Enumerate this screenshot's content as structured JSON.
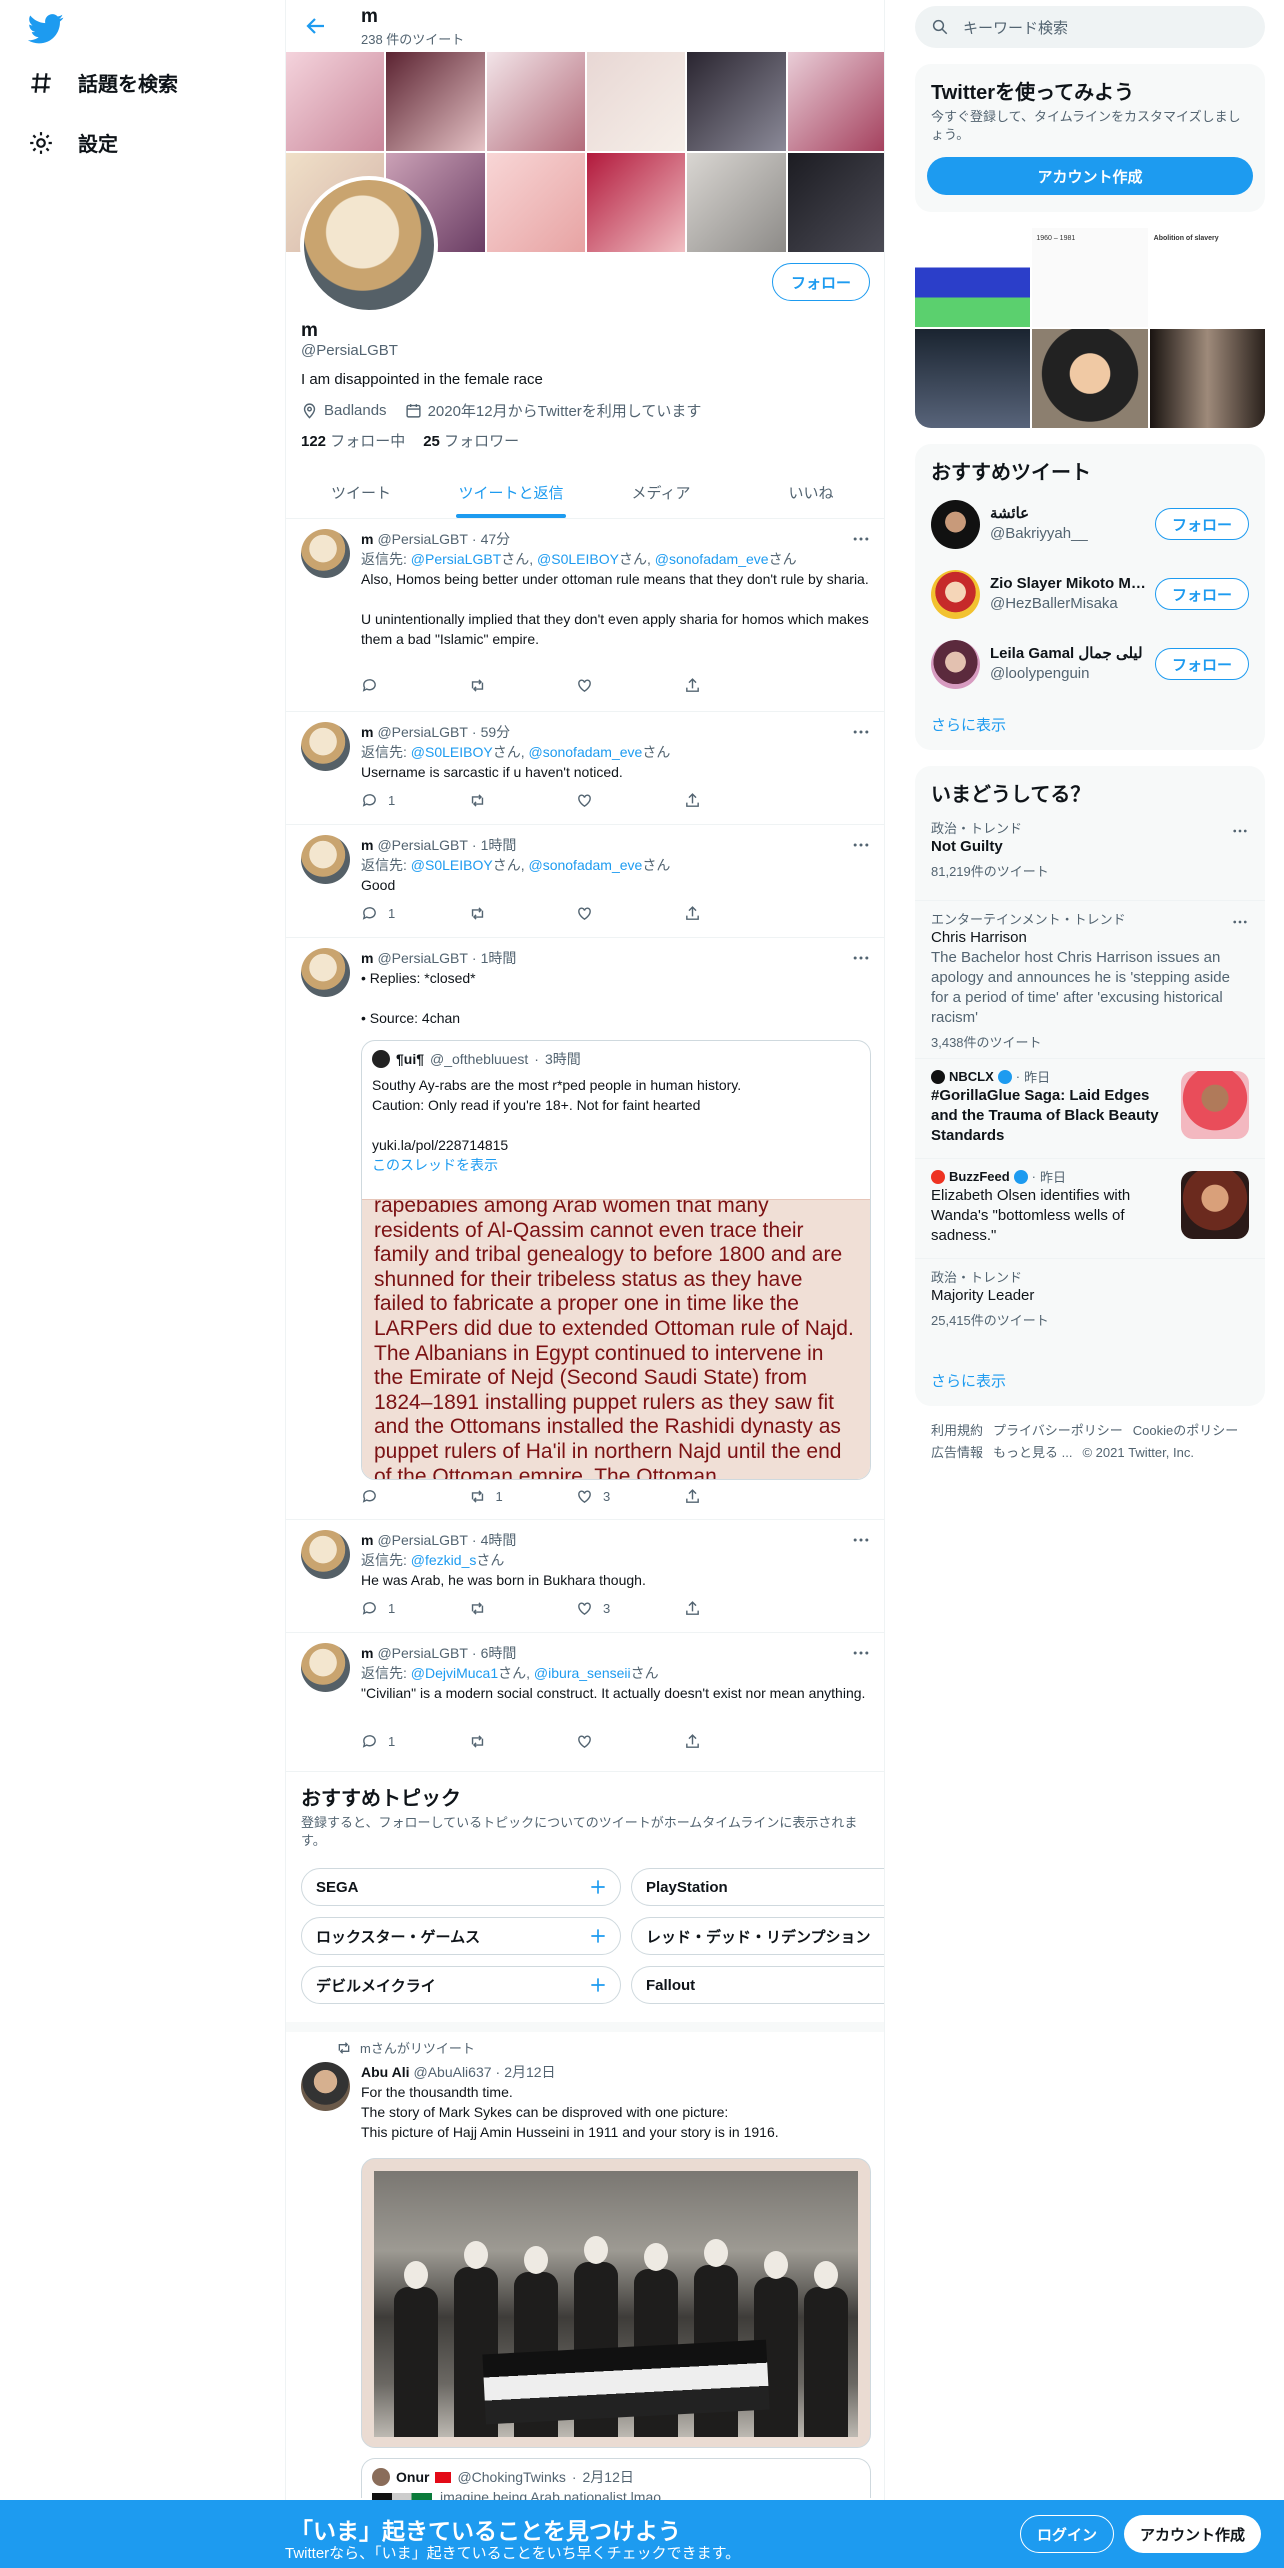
{
  "nav": {
    "explore": "話題を検索",
    "settings": "設定"
  },
  "header": {
    "name": "m",
    "tweet_count": "238 件のツイート"
  },
  "profile": {
    "name": "m",
    "handle": "@PersiaLGBT",
    "bio": "I am disappointed in the female race",
    "location": "Badlands",
    "joined": "2020年12月からTwitterを利用しています",
    "following_count": "122",
    "following_label": "フォロー中",
    "followers_count": "25",
    "followers_label": "フォロワー",
    "follow_button": "フォロー"
  },
  "tabs": [
    "ツイート",
    "ツイートと返信",
    "メディア",
    "いいね"
  ],
  "tweets": [
    {
      "name": "m",
      "handle": "@PersiaLGBT",
      "time": "47分",
      "reply_prefix": "返信先:",
      "reply_to_1": "@PersiaLGBT",
      "reply_to_2": "@S0LEIBOY",
      "reply_to_3": "@sonofadam_eve",
      "san": "さん",
      "text": "Also, Homos being better under ottoman rule means that they don't rule by sharia.\n\nU unintentionally implied that they don't even apply sharia for homos which makes them a bad \"Islamic\" empire.",
      "replies": "",
      "retweets": "",
      "likes": ""
    },
    {
      "name": "m",
      "handle": "@PersiaLGBT",
      "time": "59分",
      "reply_prefix": "返信先:",
      "reply_to_1": "@S0LEIBOY",
      "reply_to_2": "@sonofadam_eve",
      "san": "さん",
      "text": "Username is sarcastic if u haven't noticed.",
      "replies": "1",
      "retweets": "",
      "likes": ""
    },
    {
      "name": "m",
      "handle": "@PersiaLGBT",
      "time": "1時間",
      "reply_prefix": "返信先:",
      "reply_to_1": "@S0LEIBOY",
      "reply_to_2": "@sonofadam_eve",
      "san": "さん",
      "text": "Good",
      "replies": "1",
      "retweets": "",
      "likes": ""
    },
    {
      "name": "m",
      "handle": "@PersiaLGBT",
      "time": "1時間",
      "text": "• Replies: *closed*\n\n• Source: 4chan",
      "quote": {
        "name": "¶ui¶",
        "handle": "@_ofthebluuest",
        "time": "3時間",
        "text": "Southy Ay-rabs are the most r*ped people in human history.\nCaution: Only read if you're 18+. Not for faint hearted\n\nyuki.la/pol/228714815",
        "show_thread": "このスレッドを表示",
        "image_text": "rapebabies among Arab women that many residents of Al-Qassim cannot even trace their family and tribal genealogy to before 1800 and are shunned for their tribeless status as they have failed to fabricate a proper one in time like the LARPers did due to extended Ottoman rule of Najd. The Albanians in Egypt continued to intervene in the Emirate of Nejd (Second Saudi State) from 1824–1891 installing puppet rulers as they saw fit and the Ottomans installed the Rashidi dynasty as puppet rulers of Ha'il in northern Najd until the end of the Ottoman empire. The Ottoman"
      },
      "replies": "",
      "retweets": "1",
      "likes": "3"
    },
    {
      "name": "m",
      "handle": "@PersiaLGBT",
      "time": "4時間",
      "reply_prefix": "返信先:",
      "reply_to_1": "@fezkid_s",
      "san": "さん",
      "text": "He was Arab, he was born in Bukhara though.",
      "replies": "1",
      "retweets": "",
      "likes": "3"
    },
    {
      "name": "m",
      "handle": "@PersiaLGBT",
      "time": "6時間",
      "reply_prefix": "返信先:",
      "reply_to_1": "@DejviMuca1",
      "reply_to_2": "@ibura_senseii",
      "san": "さん",
      "text": "\"Civilian\" is a modern social construct. It actually doesn't exist nor mean anything.",
      "replies": "1",
      "retweets": "",
      "likes": ""
    }
  ],
  "topics": {
    "title": "おすすめトピック",
    "subtitle": "登録すると、フォローしているトピックについてのツイートがホームタイムラインに表示されます。",
    "chips": [
      "SEGA",
      "PlayStation",
      "ロックスター・ゲームス",
      "レッド・デッド・リデンプション",
      "デビルメイクライ",
      "Fallout"
    ]
  },
  "retweet": {
    "label": "mさんがリツイート",
    "name": "Abu Ali",
    "handle": "@AbuAli637",
    "time": "2月12日",
    "text": "For the thousandth time.\nThe story of Mark Sykes can be disproved with one picture:\nThis picture of Hajj Amin Husseini in 1911 and your story is in 1916.",
    "quote_name": "Onur",
    "quote_handle": "@ChokingTwinks",
    "quote_time": "2月12日",
    "quote_text": "imagine being Arab nationalist lmao"
  },
  "right": {
    "search_placeholder": "キーワード検索",
    "signup_title": "Twitterを使ってみよう",
    "signup_text": "今すぐ登録して、タイムラインをカスタマイズしましょう。",
    "signup_button": "アカウント作成",
    "media_text_1": "1960 – 1981",
    "media_text_2": "Abolition of slavery",
    "who_title": "おすすめツイート",
    "who": [
      {
        "name": "عائشة",
        "handle": "@Bakriyyah__",
        "button": "フォロー"
      },
      {
        "name": "Zio Slayer Mikoto Mis...",
        "handle": "@HezBallerMisaka",
        "button": "フォロー"
      },
      {
        "name": "Leila Gamal ليلى جمال",
        "handle": "@loolypenguin",
        "button": "フォロー"
      }
    ],
    "show_more": "さらに表示",
    "trends_title": "いまどうしてる？",
    "trends": [
      {
        "category": "政治・トレンド",
        "title": "Not Guilty",
        "count": "81,219件のツイート"
      },
      {
        "category": "エンターテインメント・トレンド",
        "title": "Chris Harrison",
        "desc": "The Bachelor host Chris Harrison issues an apology and announces he is 'stepping aside for a period of time' after 'excusing historical racism'",
        "count": "3,438件のツイート"
      },
      {
        "category": "NBCLX",
        "time": "昨日",
        "title": "#GorillaGlue Saga: Laid Edges and the Trauma of Black Beauty Standards"
      },
      {
        "category": "BuzzFeed",
        "time": "昨日",
        "title": "Elizabeth Olsen identifies with Wanda's \"bottomless wells of sadness.\""
      },
      {
        "category": "政治・トレンド",
        "title": "Majority Leader",
        "count": "25,415件のツイート"
      }
    ],
    "show_more_2": "さらに表示",
    "footer": [
      "利用規約",
      "プライバシーポリシー",
      "Cookieのポリシー",
      "広告情報",
      "もっと見る ...",
      "© 2021 Twitter, Inc."
    ]
  },
  "bottom_bar": {
    "title": "「いま」起きていることを見つけよう",
    "subtitle": "Twitterなら、「いま」起きていることをいち早くチェックできます。",
    "login": "ログイン",
    "signup": "アカウント作成"
  }
}
